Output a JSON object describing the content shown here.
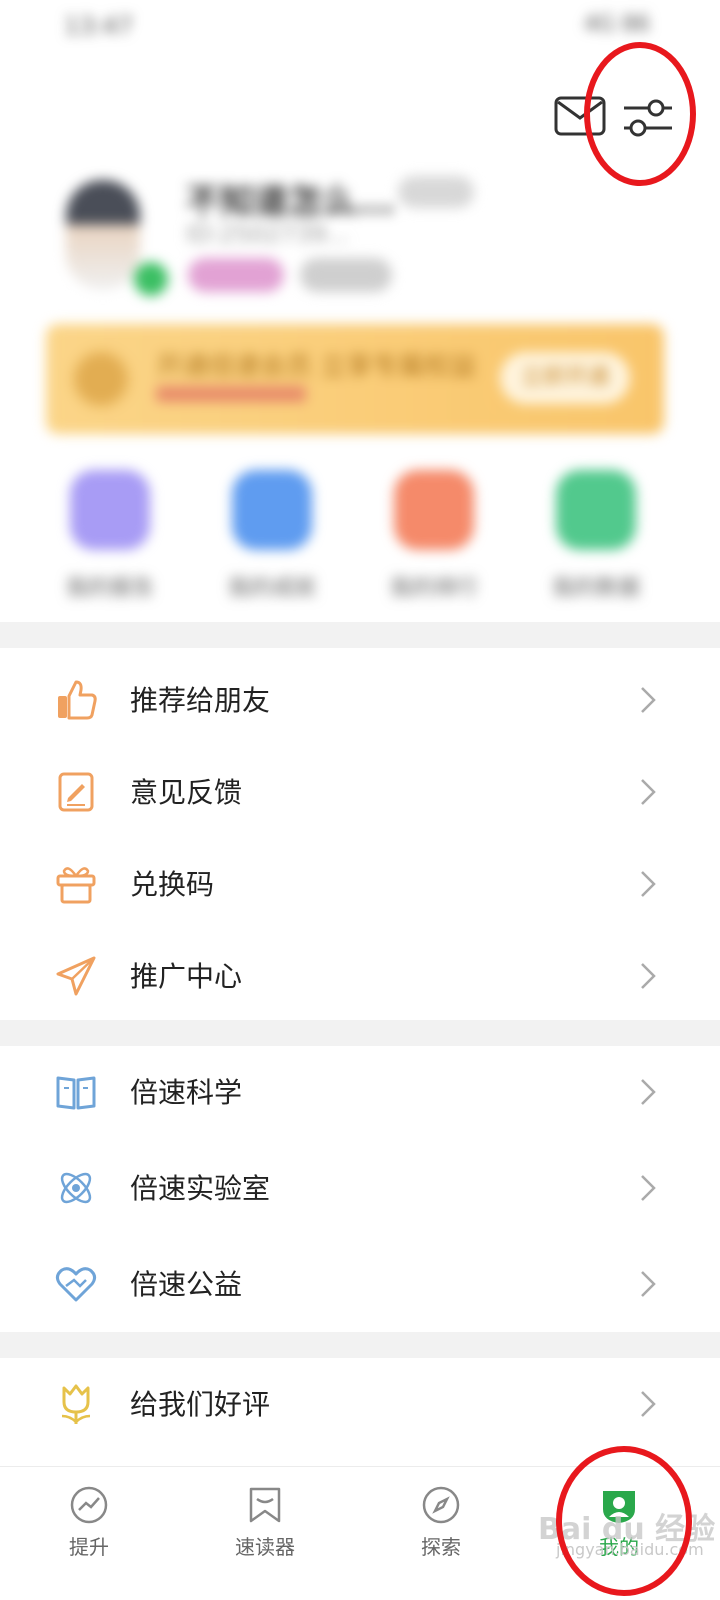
{
  "status_bar": {
    "time": "13:47",
    "indicators": "4G 86"
  },
  "header": {
    "mail_icon": "mail-icon",
    "settings_icon": "settings-sliders-icon"
  },
  "profile": {
    "nickname": "不知道怎么...",
    "uid": "ID:2502739...",
    "badge_color": "#3bbf63"
  },
  "banner": {
    "text": "开通倍速会员 立享专属权益",
    "button_label": "立即开通"
  },
  "quick_entries": [
    {
      "label": "我的报告",
      "color": "#a89cf5"
    },
    {
      "label": "我的成就",
      "color": "#5f9cf0"
    },
    {
      "label": "我的排行",
      "color": "#f58a6a"
    },
    {
      "label": "我的数据",
      "color": "#52c98d"
    }
  ],
  "menu_groups": [
    [
      {
        "label": "推荐给朋友",
        "icon": "thumbs-up-icon"
      },
      {
        "label": "意见反馈",
        "icon": "edit-note-icon"
      },
      {
        "label": "兑换码",
        "icon": "gift-icon"
      },
      {
        "label": "推广中心",
        "icon": "paper-plane-icon"
      }
    ],
    [
      {
        "label": "倍速科学",
        "icon": "open-book-icon"
      },
      {
        "label": "倍速实验室",
        "icon": "atom-icon"
      },
      {
        "label": "倍速公益",
        "icon": "heart-icon"
      }
    ],
    [
      {
        "label": "给我们好评",
        "icon": "tulip-icon"
      }
    ]
  ],
  "bottom_nav": [
    {
      "label": "提升",
      "icon": "trend-icon",
      "active": false
    },
    {
      "label": "速读器",
      "icon": "bookmark-icon",
      "active": false
    },
    {
      "label": "探索",
      "icon": "compass-icon",
      "active": false
    },
    {
      "label": "我的",
      "icon": "profile-icon",
      "active": true
    }
  ],
  "watermark": {
    "text": "Bai du 经验",
    "sub": "jingyan.baidu.com"
  },
  "colors": {
    "active": "#2aa84b",
    "orange_icon": "#f0a160",
    "blue_icon": "#6fa4d8",
    "highlight_ring": "#e8181d"
  }
}
